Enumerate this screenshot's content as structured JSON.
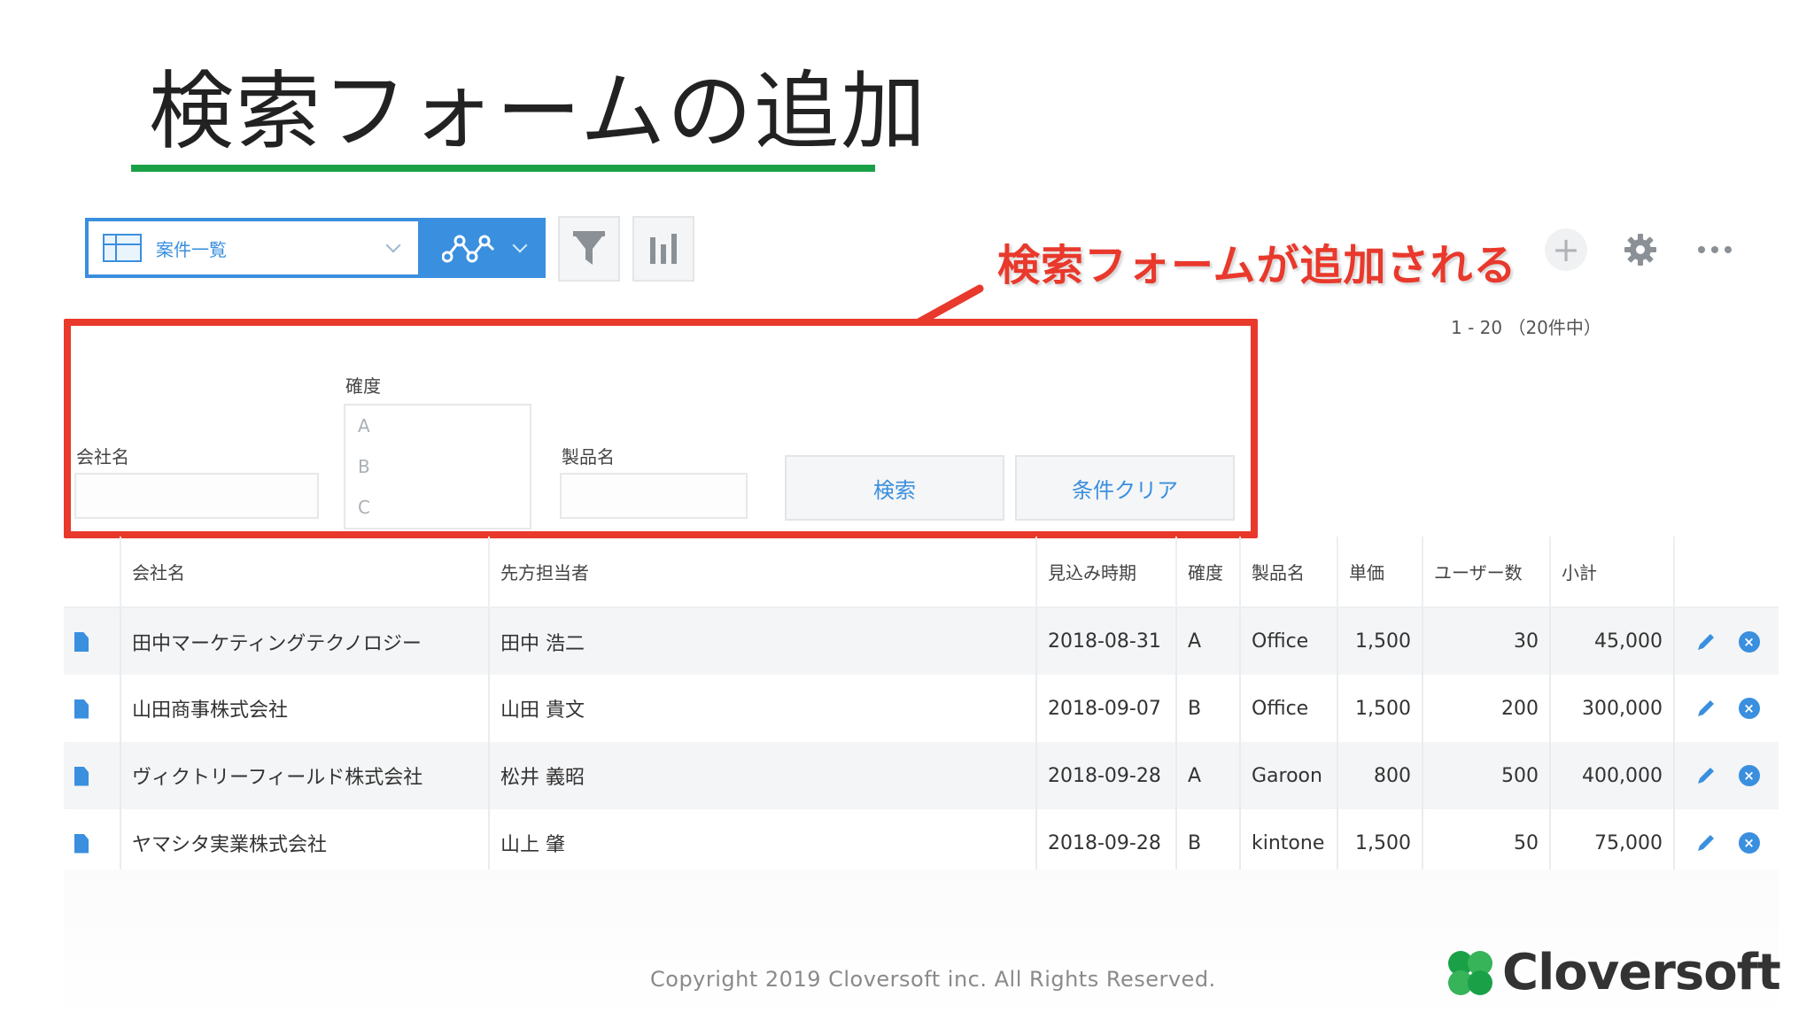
{
  "slide": {
    "title": "検索フォームの追加",
    "callout": "検索フォームが追加される",
    "copyright": "Copyright 2019 Cloversoft inc. All Rights Reserved.",
    "logo_text": "Cloversoft",
    "colors": {
      "accent_green": "#1aa147",
      "callout_red": "#e8392c",
      "kintone_blue": "#3a8fde"
    }
  },
  "toolbar": {
    "view_select": "案件一覧",
    "icons": [
      "table-view-icon",
      "graph-icon",
      "filter-icon",
      "bar-chart-icon",
      "plus-icon",
      "gear-icon",
      "more-icon"
    ],
    "add": "+",
    "pager": "1 - 20 （20件中）"
  },
  "search_form": {
    "company_label": "会社名",
    "company_value": "",
    "certainty_label": "確度",
    "certainty_options": [
      "A",
      "B",
      "C"
    ],
    "product_label": "製品名",
    "product_value": "",
    "search_button": "検索",
    "clear_button": "条件クリア"
  },
  "table": {
    "headers": [
      "会社名",
      "先方担当者",
      "見込み時期",
      "確度",
      "製品名",
      "単価",
      "ユーザー数",
      "小計"
    ],
    "rows": [
      [
        "田中マーケティングテクノロジー",
        "田中 浩二",
        "2018-08-31",
        "A",
        "Office",
        "1,500",
        "30",
        "45,000"
      ],
      [
        "山田商事株式会社",
        "山田 貴文",
        "2018-09-07",
        "B",
        "Office",
        "1,500",
        "200",
        "300,000"
      ],
      [
        "ヴィクトリーフィールド株式会社",
        "松井 義昭",
        "2018-09-28",
        "A",
        "Garoon",
        "800",
        "500",
        "400,000"
      ],
      [
        "ヤマシタ実業株式会社",
        "山上 肇",
        "2018-09-28",
        "B",
        "kintone",
        "1,500",
        "50",
        "75,000"
      ]
    ],
    "delete_glyph": "×"
  }
}
